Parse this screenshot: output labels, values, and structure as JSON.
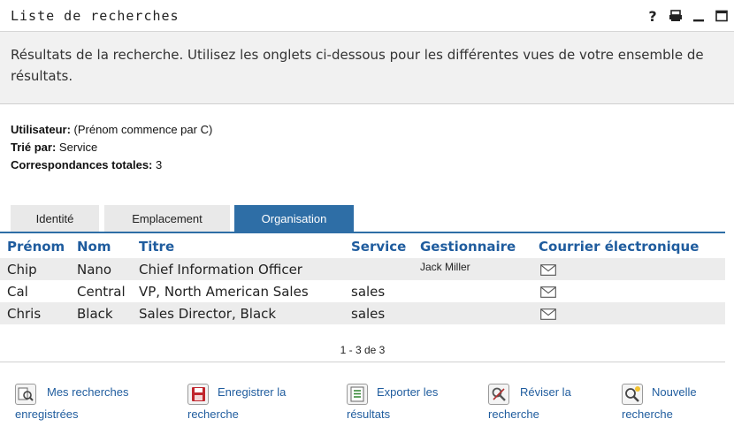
{
  "window": {
    "title": "Liste de recherches",
    "controls": [
      {
        "name": "help-icon",
        "glyph": "?"
      },
      {
        "name": "print-icon"
      },
      {
        "name": "minimize-icon"
      },
      {
        "name": "maximize-icon"
      }
    ]
  },
  "description": "Résultats de la recherche. Utilisez les onglets ci-dessous pour les différentes vues de votre ensemble de résultats.",
  "criteria": {
    "user_label": "Utilisateur:",
    "user_value": "(Prénom commence par C)",
    "sort_label": "Trié par:",
    "sort_value": "Service",
    "total_label": "Correspondances totales:",
    "total_value": "3"
  },
  "tabs": [
    {
      "label": "Identité",
      "active": false
    },
    {
      "label": "Emplacement",
      "active": false
    },
    {
      "label": "Organisation",
      "active": true
    }
  ],
  "table": {
    "headers": [
      "Prénom",
      "Nom",
      "Titre",
      "Service",
      "Gestionnaire",
      "Courrier électronique"
    ],
    "rows": [
      {
        "first": "Chip",
        "last": "Nano",
        "title": "Chief Information Officer",
        "service": "",
        "manager": "Jack Miller",
        "email_icon": "envelope-icon"
      },
      {
        "first": "Cal",
        "last": "Central",
        "title": "VP, North American Sales",
        "service": "sales",
        "manager": "",
        "email_icon": "envelope-icon"
      },
      {
        "first": "Chris",
        "last": "Black",
        "title": "Sales Director, Black",
        "service": "sales",
        "manager": "",
        "email_icon": "envelope-icon"
      }
    ]
  },
  "pager": "1 - 3 de 3",
  "actions": [
    {
      "line1": "Mes recherches",
      "line2": "enregistrées",
      "icon": "saved-searches-icon"
    },
    {
      "line1": "Enregistrer la",
      "line2": "recherche",
      "icon": "save-icon"
    },
    {
      "line1": "Exporter les",
      "line2": "résultats",
      "icon": "export-icon"
    },
    {
      "line1": "Réviser la",
      "line2": "recherche",
      "icon": "revise-icon"
    },
    {
      "line1": "Nouvelle",
      "line2": "recherche",
      "icon": "new-search-icon"
    }
  ],
  "colors": {
    "accent": "#2e6ea6",
    "header_text": "#1f5c9e",
    "row_stripe": "#ececec",
    "description_bg": "#f1f1f1"
  }
}
